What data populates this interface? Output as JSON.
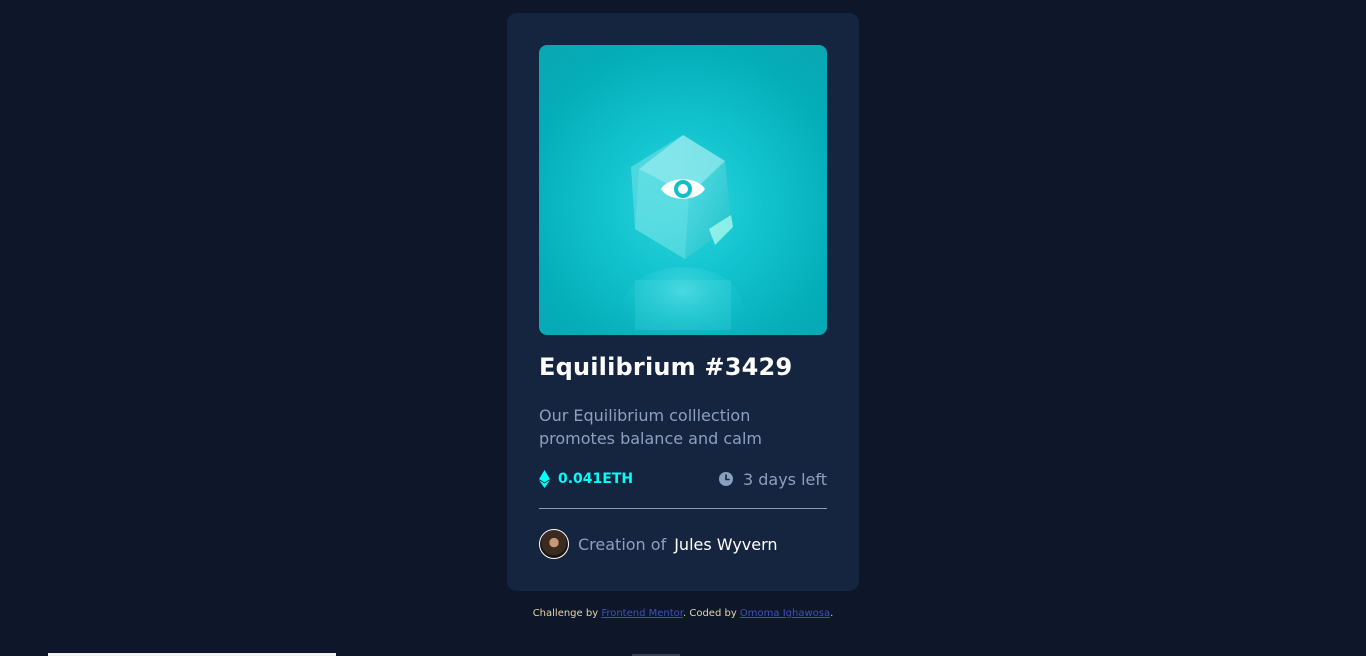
{
  "card": {
    "image_alt": "equilibrium-cube",
    "overlay_icon": "eye-icon",
    "title": "Equilibrium #3429",
    "description": "Our Equilibrium colllection promotes balance and calm",
    "price": "0.041ETH",
    "price_icon": "ethereum-icon",
    "time_left": "3 days left",
    "time_icon": "clock-icon",
    "creator_prefix": "Creation of",
    "creator_name": "Jules Wyvern"
  },
  "attribution": {
    "prefix": "Challenge by ",
    "link1": "Frontend Mentor",
    "middle": ". Coded by ",
    "link2": "Omoma Ighawosa",
    "suffix": "."
  },
  "colors": {
    "background": "#0d1729",
    "card": "#15253f",
    "cyan": "#00fff7",
    "soft_blue": "#8ba0c1",
    "white": "#ffffff"
  }
}
